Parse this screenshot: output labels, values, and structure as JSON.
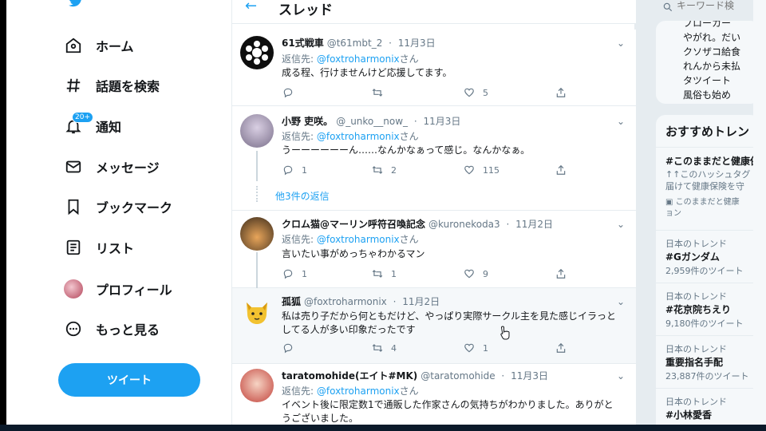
{
  "nav": {
    "items": [
      {
        "label": "ホーム",
        "icon": "home-icon"
      },
      {
        "label": "話題を検索",
        "icon": "hashtag-icon"
      },
      {
        "label": "通知",
        "icon": "bell-icon",
        "badge": "20+"
      },
      {
        "label": "メッセージ",
        "icon": "mail-icon"
      },
      {
        "label": "ブックマーク",
        "icon": "bookmark-icon"
      },
      {
        "label": "リスト",
        "icon": "list-icon"
      },
      {
        "label": "プロフィール",
        "icon": "avatar"
      },
      {
        "label": "もっと見る",
        "icon": "more-icon"
      }
    ],
    "tweet_button": "ツイート"
  },
  "header": {
    "title": "スレッド"
  },
  "tweets": [
    {
      "name": "61式戦車",
      "handle": "@t61mbt_2",
      "date": "11月3日",
      "reply_prefix": "返信先:",
      "reply_to": "@foxtroharmonix",
      "reply_suffix": "さん",
      "text": "成る程、行けませんけど応援してます。",
      "replies": "",
      "retweets": "",
      "likes": "5"
    },
    {
      "name": "小野 吏咲。",
      "handle": "@_unko__now_",
      "date": "11月3日",
      "reply_prefix": "返信先:",
      "reply_to": "@foxtroharmonix",
      "reply_suffix": "さん",
      "text": "うーーーーーーん……なんかなぁって感じ。なんかなぁ。",
      "replies": "1",
      "retweets": "2",
      "likes": "115"
    },
    {
      "name": "クロム猫@マーリン呼符召喚記念",
      "handle": "@kuronekoda3",
      "date": "11月2日",
      "reply_prefix": "返信先:",
      "reply_to": "@foxtroharmonix",
      "reply_suffix": "さん",
      "text": "言いたい事がめっちゃわかるマン",
      "replies": "1",
      "retweets": "1",
      "likes": "9"
    },
    {
      "name": "孤狐",
      "handle": "@foxtroharmonix",
      "date": "11月2日",
      "text": "私は売り子だから何ともだけど、やっぱり実際サークル主を見た感じイラっとしてる人が多い印象だったです",
      "replies": "",
      "retweets": "4",
      "likes": "1"
    },
    {
      "name": "taratomohide(エイト#MK)",
      "handle": "@taratomohide",
      "date": "11月3日",
      "reply_prefix": "返信先:",
      "reply_to": "@foxtroharmonix",
      "reply_suffix": "さん",
      "text": "イベント後に限定数1で通販した作家さんの気持ちがわかりました。ありがとうございました。"
    }
  ],
  "more_replies": "他3件の返信",
  "right": {
    "search_placeholder": "キーワード検",
    "card_lines": [
      "ブローカー",
      "やがれ。だい",
      "クソザコ給食",
      "れんから未払",
      "タツイート",
      "風俗も始め"
    ],
    "trends_title": "おすすめトレン",
    "trends": [
      {
        "name": "#このままだと健康保険",
        "desc1": "↑↑このハッシュタグ",
        "desc2": "届けて健康保険を守",
        "promo1": "このままだと健康",
        "promo2": "ョン"
      },
      {
        "meta": "日本のトレンド",
        "name": "#Gガンダム",
        "count": "2,959件のツイート"
      },
      {
        "meta": "日本のトレンド",
        "name": "#花京院ちえり",
        "count": "9,180件のツイート"
      },
      {
        "meta": "日本のトレンド",
        "name": "重要指名手配",
        "count": "23,887件のツイート"
      },
      {
        "meta": "日本のトレンド",
        "name": "#小林愛香"
      }
    ]
  },
  "colors": {
    "accent": "#1da1f2",
    "text": "#14171a",
    "muted": "#657786",
    "border": "#e6ecf0"
  }
}
